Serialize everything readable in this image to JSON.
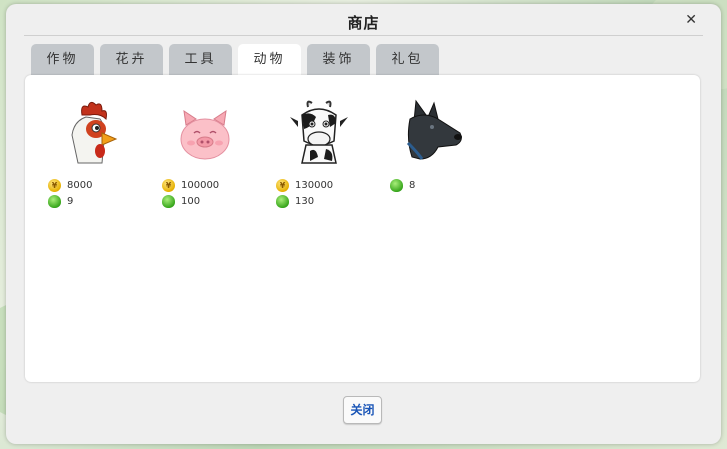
{
  "dialog": {
    "title": "商店",
    "close_symbol": "✕"
  },
  "tabs": [
    {
      "label": "作物",
      "active": false
    },
    {
      "label": "花卉",
      "active": false
    },
    {
      "label": "工具",
      "active": false
    },
    {
      "label": "动物",
      "active": true
    },
    {
      "label": "装饰",
      "active": false
    },
    {
      "label": "礼包",
      "active": false
    }
  ],
  "items": [
    {
      "icon": "rooster-icon",
      "coin_price": "8000",
      "gem_price": "9"
    },
    {
      "icon": "pig-icon",
      "coin_price": "100000",
      "gem_price": "100"
    },
    {
      "icon": "cow-icon",
      "coin_price": "130000",
      "gem_price": "130"
    },
    {
      "icon": "dog-icon",
      "gem_price": "8"
    }
  ],
  "close_button": {
    "label": "关闭"
  },
  "colors": {
    "tab_inactive": "#c3c7cb",
    "tab_active": "#ffffff",
    "close_label": "#1a55b7",
    "coin": "#e6b000",
    "gem": "#39a71d"
  }
}
